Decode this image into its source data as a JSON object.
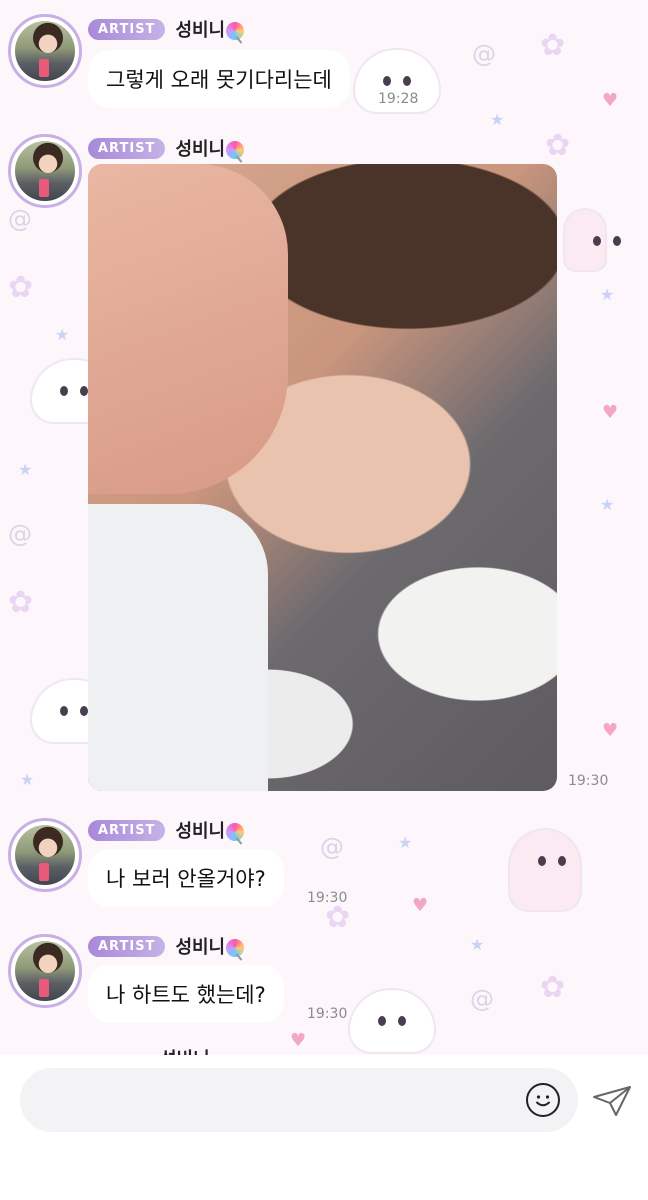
{
  "messages": [
    {
      "badge": "ARTIST",
      "sender": "성비니",
      "text": "그렇게 오래 못기다리는데",
      "time": "19:28"
    },
    {
      "badge": "ARTIST",
      "sender": "성비니",
      "type": "photo",
      "time": "19:30"
    },
    {
      "badge": "ARTIST",
      "sender": "성비니",
      "text": "나 보러 안올거야?",
      "time": "19:30"
    },
    {
      "badge": "ARTIST",
      "sender": "성비니",
      "text": "나 하트도 했는데?",
      "time": "19:30"
    },
    {
      "sender": "성비니"
    }
  ],
  "composer": {
    "placeholder": "",
    "emoji_icon": "smile-icon",
    "send_icon": "paper-plane-icon"
  },
  "colors": {
    "badge": "#b39ae0",
    "avatar_ring": "#c8b0e6",
    "bubble": "#ffffff",
    "background": "#fdf7fc"
  }
}
